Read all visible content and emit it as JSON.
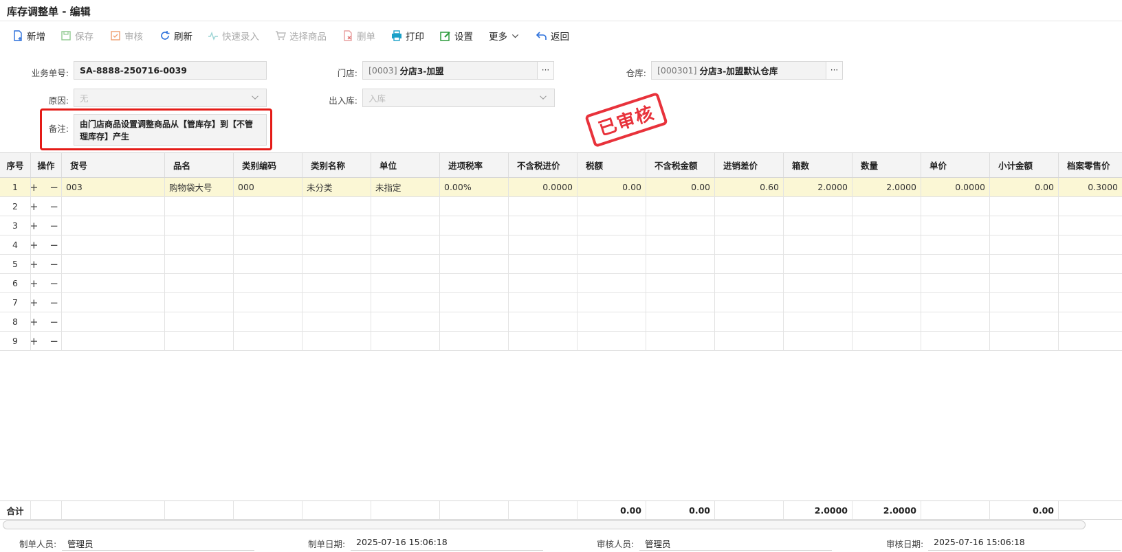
{
  "window": {
    "title": "库存调整单 - 编辑"
  },
  "toolbar": {
    "new": "新增",
    "save": "保存",
    "audit": "审核",
    "refresh": "刷新",
    "quick_entry": "快速录入",
    "select_goods": "选择商品",
    "delete": "删单",
    "print": "打印",
    "settings": "设置",
    "more": "更多",
    "back": "返回"
  },
  "form": {
    "order_no_label": "业务单号:",
    "order_no": "SA-8888-250716-0039",
    "store_label": "门店:",
    "store_code": "[0003]",
    "store_name": "分店3-加盟",
    "warehouse_label": "仓库:",
    "warehouse_code": "[000301]",
    "warehouse_name": "分店3-加盟默认仓库",
    "reason_label": "原因:",
    "reason_value": "无",
    "inout_label": "出入库:",
    "inout_value": "入库",
    "remark_label": "备注:",
    "remark_value": "由门店商品设置调整商品从【管库存】到【不管理库存】产生",
    "dots": "···"
  },
  "stamp": "已审核",
  "grid": {
    "headers": [
      "序号",
      "操作",
      "货号",
      "品名",
      "类别编码",
      "类别名称",
      "单位",
      "进项税率",
      "不含税进价",
      "税额",
      "不含税金额",
      "进销差价",
      "箱数",
      "数量",
      "单价",
      "小计金额",
      "档案零售价"
    ],
    "row1": [
      "1",
      "+ −",
      "003",
      "购物袋大号",
      "000",
      "未分类",
      "未指定",
      "0.00%",
      "0.0000",
      "0.00",
      "0.00",
      "0.60",
      "2.0000",
      "2.0000",
      "0.0000",
      "0.00",
      "0.3000"
    ],
    "empty_rows": [
      "2",
      "3",
      "4",
      "5",
      "6",
      "7",
      "8",
      "9"
    ],
    "ops": "+ −",
    "total_label": "合计",
    "totals": {
      "tax": "0.00",
      "amount_ex_tax": "0.00",
      "boxes": "2.0000",
      "qty": "2.0000",
      "subtotal": "0.00"
    }
  },
  "footer": {
    "creator_label": "制单人员:",
    "creator": "管理员",
    "create_date_label": "制单日期:",
    "create_date": "2025-07-16 15:06:18",
    "auditor_label": "审核人员:",
    "auditor": "管理员",
    "audit_date_label": "审核日期:",
    "audit_date": "2025-07-16 15:06:18"
  },
  "colors": {
    "stamp": "#e8323b",
    "highlight_border": "#e41b17",
    "selected_row": "#fbf7d5"
  }
}
